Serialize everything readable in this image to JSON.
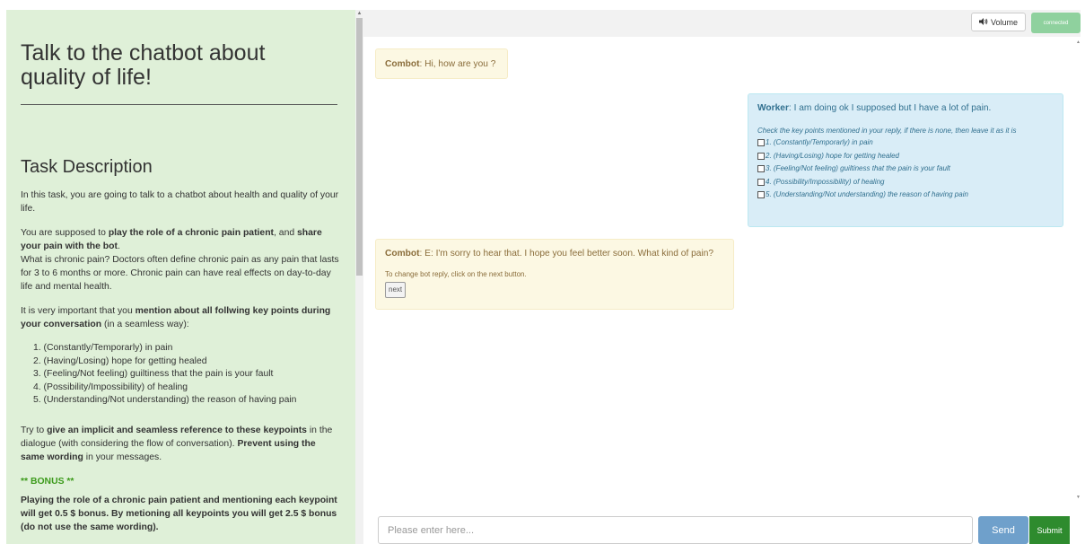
{
  "left_panel": {
    "title": "Talk to the chatbot about quality of life!",
    "task_heading": "Task Description",
    "intro": "In this task, you are going to talk to a chatbot about health and quality of your life.",
    "role_pre": "You are supposed to ",
    "role_bold1": "play the role of a chronic pain patient",
    "role_mid": ", and ",
    "role_bold2": "share your pain with the bot",
    "role_post": ".",
    "chronic_def": "What is chronic pain? Doctors often define chronic pain as any pain that lasts for 3 to 6 months or more. Chronic pain can have real effects on day-to-day life and mental health.",
    "important_pre": "It is very important that you ",
    "important_bold": "mention about all follwing key points during your conversation",
    "important_post": " (in a seamless way):",
    "key_points": [
      "1. (Constantly/Temporarly) in pain",
      "2. (Having/Losing) hope for getting healed",
      "3. (Feeling/Not feeling) guiltiness that the pain is your fault",
      "4. (Possibility/Impossibility) of healing",
      "5. (Understanding/Not understanding) the reason of having pain"
    ],
    "try_pre": "Try to ",
    "try_bold1": "give an implicit and seamless reference to these keypoints",
    "try_mid": " in the dialogue (with considering the flow of conversation). ",
    "try_bold2": "Prevent using the same wording",
    "try_post": " in your messages.",
    "bonus_heading": "** BONUS **",
    "bonus_text": "Playing the role of a chronic pain patient and mentioning each keypoint will get 0.5 $ bonus. By metioning all keypoints you will get 2.5 $ bonus (do not use the same wording)."
  },
  "header": {
    "volume_label": "Volume",
    "volume_icon": "speaker-icon",
    "status_badge": "connected"
  },
  "messages": {
    "m1": {
      "speaker": "Combot",
      "text": ": Hi, how are you ?"
    },
    "m2": {
      "speaker": "Worker",
      "text": ": I am doing ok I supposed but I have a lot of pain.",
      "check_hint": "Check the key points mentioned in your reply, if there is none, then leave it as it is",
      "checks": [
        "1. (Constantly/Temporarly) in pain",
        "2. (Having/Losing) hope for getting healed",
        "3. (Feeling/Not feeling) guiltiness that the pain is your fault",
        "4. (Possibility/Impossibility) of healing",
        "5. (Understanding/Not understanding) the reason of having pain"
      ]
    },
    "m3": {
      "speaker": "Combot",
      "text": ": E:  I'm sorry to hear that. I hope you feel better soon. What kind of pain?",
      "change_hint": "To change bot reply, click on the next button.",
      "next_label": "next"
    }
  },
  "input_bar": {
    "placeholder": "Please enter here...",
    "send_label": "Send",
    "submit_label": "Submit"
  },
  "colors": {
    "left_panel_bg": "#dff0d8",
    "bot_bubble": "#fcf8e3",
    "worker_bubble": "#d9edf7",
    "send_button": "#6fa0cb",
    "submit_button": "#2e8b2e",
    "connected_badge": "#8fd19e",
    "bonus_heading": "#3c9a1b"
  }
}
